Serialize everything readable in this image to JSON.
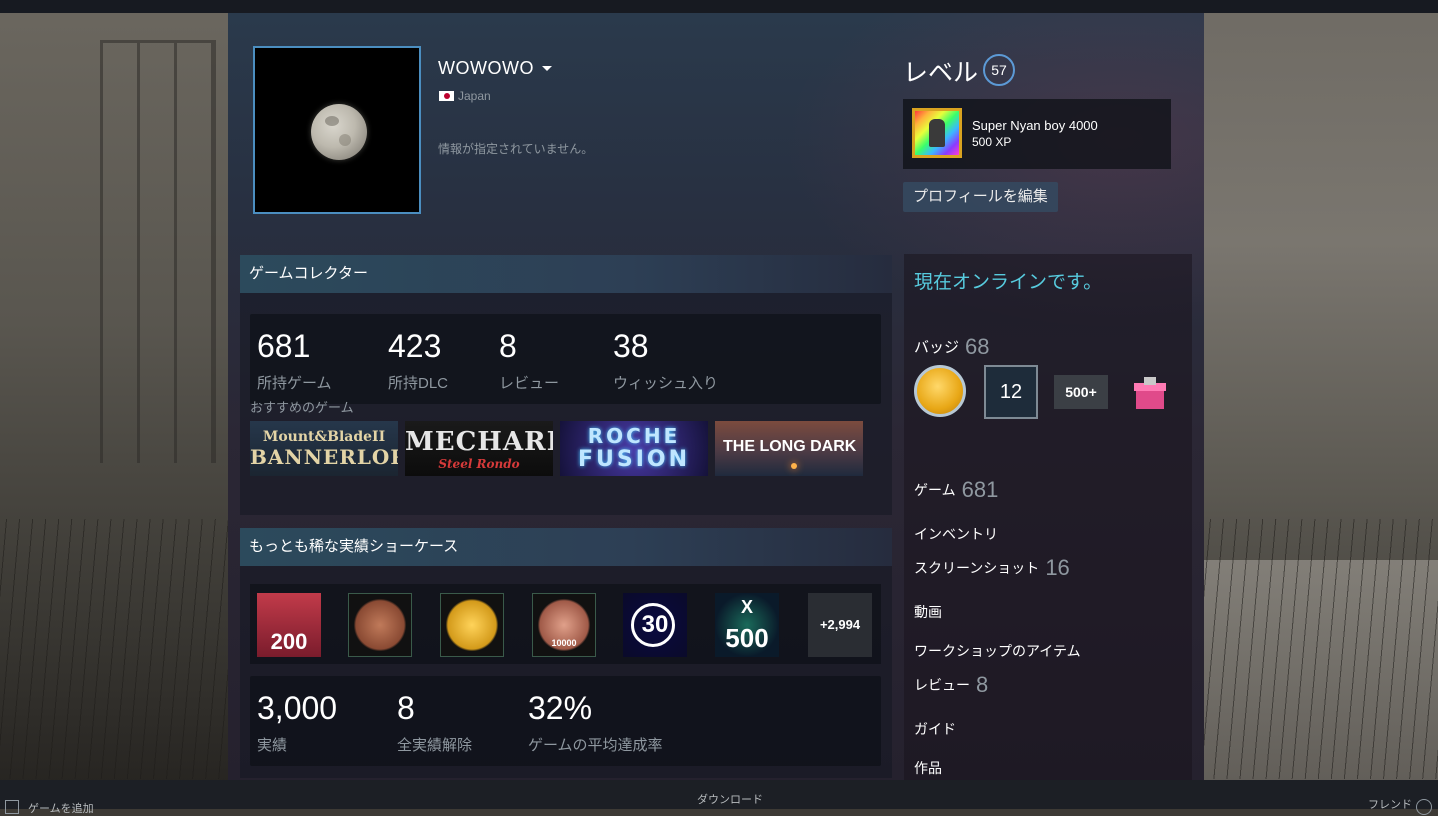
{
  "profile": {
    "username": "WOWOWO",
    "country": "Japan",
    "summary": "情報が指定されていません。",
    "level_label": "レベル",
    "level": "57",
    "featured_badge": {
      "name": "Super Nyan boy 4000",
      "xp": "500 XP"
    },
    "edit_button": "プロフィールを編集"
  },
  "collector": {
    "title": "ゲームコレクター",
    "stats": [
      {
        "value": "681",
        "label": "所持ゲーム"
      },
      {
        "value": "423",
        "label": "所持DLC"
      },
      {
        "value": "8",
        "label": "レビュー"
      },
      {
        "value": "38",
        "label": "ウィッシュ入り"
      }
    ],
    "recommended_label": "おすすめのゲーム",
    "games": [
      {
        "line1": "Mount&BladeII",
        "line2": "BANNERLORD"
      },
      {
        "line1": "MECHARITZ",
        "line2": "Steel Rondo"
      },
      {
        "line1": "ROCHE",
        "line2": "FUSION"
      },
      {
        "line1": "THE LONG DARK"
      }
    ]
  },
  "achievements": {
    "title": "もっとも稀な実績ショーケース",
    "icons": [
      {
        "name": "trophy-200",
        "label": "200"
      },
      {
        "name": "bronze-medal-1",
        "label": ""
      },
      {
        "name": "gold-runner",
        "label": ""
      },
      {
        "name": "bronze-10000",
        "label": "10000"
      },
      {
        "name": "timer-30",
        "label": "30"
      },
      {
        "name": "x-500",
        "label": "500"
      }
    ],
    "more": "+2,994",
    "stats": [
      {
        "value": "3,000",
        "label": "実績"
      },
      {
        "value": "8",
        "label": "全実績解除"
      },
      {
        "value": "32%",
        "label": "ゲームの平均達成率"
      }
    ]
  },
  "sidebar": {
    "status": "現在オンラインです。",
    "badges_label": "バッジ",
    "badges_count": "68",
    "badge_items": [
      {
        "name": "gold-coin-badge",
        "label": ""
      },
      {
        "name": "years-badge",
        "label": "12"
      },
      {
        "name": "games-badge",
        "label": "500+"
      },
      {
        "name": "gift-badge",
        "label": ""
      }
    ],
    "links": [
      {
        "label": "ゲーム",
        "count": "681"
      },
      {
        "label": "インベントリ",
        "count": ""
      },
      {
        "label": "スクリーンショット",
        "count": "16"
      },
      {
        "label": "動画",
        "count": ""
      },
      {
        "label": "ワークショップのアイテム",
        "count": ""
      },
      {
        "label": "レビュー",
        "count": "8"
      },
      {
        "label": "ガイド",
        "count": ""
      },
      {
        "label": "作品",
        "count": ""
      }
    ]
  },
  "bottombar": {
    "add_game": "ゲームを追加",
    "downloads": "ダウンロード",
    "friends": "フレンド"
  }
}
